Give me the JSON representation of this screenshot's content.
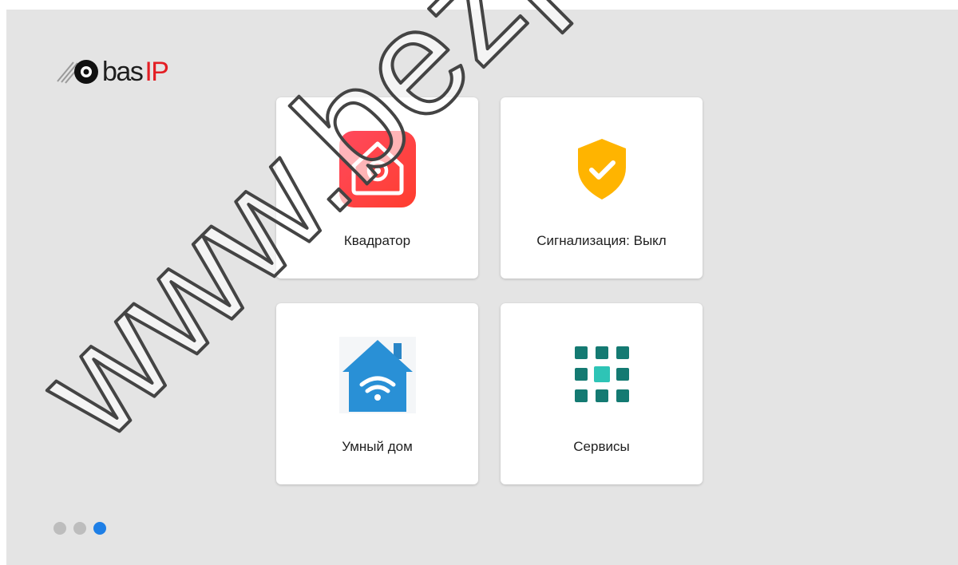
{
  "logo": {
    "bas": "bas",
    "ip": "IP"
  },
  "tiles": [
    {
      "label": "Квадратор",
      "icon": "camera-house-icon",
      "color": "#f2364b"
    },
    {
      "label": "Сигнализация: Выкл",
      "icon": "shield-check-icon",
      "color": "#ffb400"
    },
    {
      "label": "Умный дом",
      "icon": "smart-home-wifi-icon",
      "color": "#2990d6"
    },
    {
      "label": "Сервисы",
      "icon": "apps-grid-icon",
      "color": "#147a72"
    }
  ],
  "pager": {
    "count": 3,
    "active_index": 2,
    "active_color": "#1e7fe6"
  },
  "watermark": "www.bezpeka"
}
